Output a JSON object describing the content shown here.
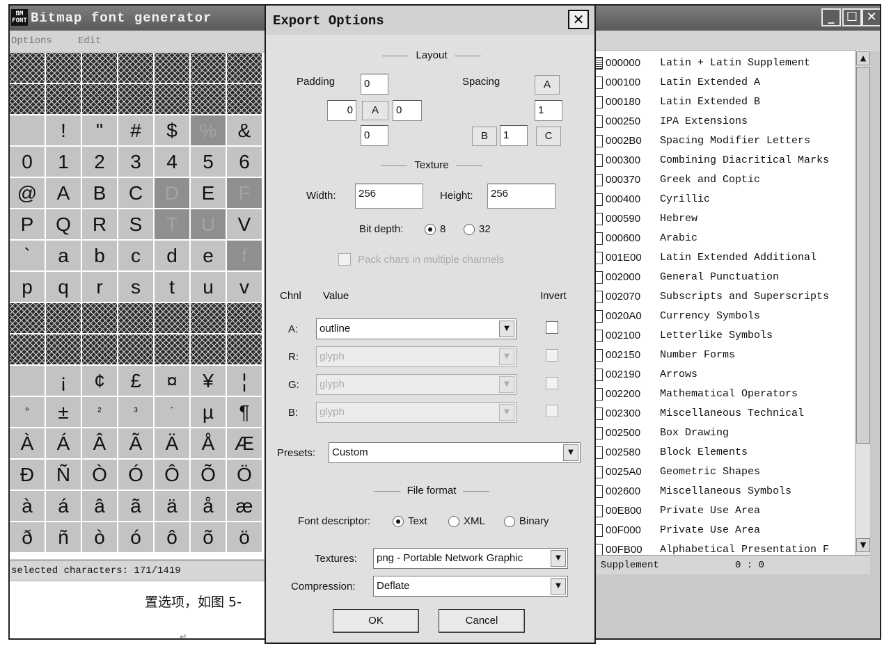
{
  "app": {
    "title": "Bitmap font generator",
    "icon_text": "BM\nFONT",
    "menu": [
      "Options",
      "Edit"
    ],
    "window_buttons": [
      "_",
      "☐",
      "✕"
    ]
  },
  "char_grid": {
    "rows": [
      {
        "type": "hatch"
      },
      {
        "type": "hatch"
      },
      {
        "cells": [
          " ",
          "!",
          "\"",
          "#",
          "$",
          "%",
          "&"
        ],
        "selected": [
          5
        ]
      },
      {
        "cells": [
          "0",
          "1",
          "2",
          "3",
          "4",
          "5",
          "6"
        ],
        "selected": []
      },
      {
        "cells": [
          "@",
          "A",
          "B",
          "C",
          "D",
          "E",
          "F"
        ],
        "selected": [
          4,
          6
        ]
      },
      {
        "cells": [
          "P",
          "Q",
          "R",
          "S",
          "T",
          "U",
          "V"
        ],
        "selected": [
          4,
          5
        ]
      },
      {
        "cells": [
          "`",
          "a",
          "b",
          "c",
          "d",
          "e",
          "f"
        ],
        "selected": [
          6
        ]
      },
      {
        "cells": [
          "p",
          "q",
          "r",
          "s",
          "t",
          "u",
          "v"
        ],
        "selected": []
      },
      {
        "type": "hatch"
      },
      {
        "type": "hatch"
      },
      {
        "cells": [
          " ",
          "¡",
          "¢",
          "£",
          "¤",
          "¥",
          "¦"
        ],
        "selected": []
      },
      {
        "cells": [
          "°",
          "±",
          "²",
          "³",
          "´",
          "µ",
          "¶"
        ],
        "selected": [],
        "small": [
          0,
          2,
          3,
          4
        ]
      },
      {
        "cells": [
          "À",
          "Á",
          "Â",
          "Ã",
          "Ä",
          "Å",
          "Æ"
        ],
        "selected": []
      },
      {
        "cells": [
          "Ð",
          "Ñ",
          "Ò",
          "Ó",
          "Ô",
          "Õ",
          "Ö"
        ],
        "selected": []
      },
      {
        "cells": [
          "à",
          "á",
          "â",
          "ã",
          "ä",
          "å",
          "æ"
        ],
        "selected": []
      },
      {
        "cells": [
          "ð",
          "ñ",
          "ò",
          "ó",
          "ô",
          "õ",
          "ö"
        ],
        "selected": []
      }
    ]
  },
  "status_left": "selected characters: 171/1419",
  "doc_text": "置选项，如图 5-",
  "doc_cursor": "↵",
  "status_right": {
    "label": "n Supplement",
    "position": "0 : 0"
  },
  "ranges": [
    {
      "code": "000000",
      "name": "Latin + Latin Supplement",
      "state": "partial"
    },
    {
      "code": "000100",
      "name": "Latin Extended A",
      "state": "off"
    },
    {
      "code": "000180",
      "name": "Latin Extended B",
      "state": "off"
    },
    {
      "code": "000250",
      "name": "IPA Extensions",
      "state": "off"
    },
    {
      "code": "0002B0",
      "name": "Spacing Modifier Letters",
      "state": "off"
    },
    {
      "code": "000300",
      "name": "Combining Diacritical Marks",
      "state": "off"
    },
    {
      "code": "000370",
      "name": "Greek and Coptic",
      "state": "off"
    },
    {
      "code": "000400",
      "name": "Cyrillic",
      "state": "off"
    },
    {
      "code": "000590",
      "name": "Hebrew",
      "state": "off"
    },
    {
      "code": "000600",
      "name": "Arabic",
      "state": "off"
    },
    {
      "code": "001E00",
      "name": "Latin Extended Additional",
      "state": "off"
    },
    {
      "code": "002000",
      "name": "General Punctuation",
      "state": "off"
    },
    {
      "code": "002070",
      "name": "Subscripts and Superscripts",
      "state": "off"
    },
    {
      "code": "0020A0",
      "name": "Currency Symbols",
      "state": "off"
    },
    {
      "code": "002100",
      "name": "Letterlike Symbols",
      "state": "off"
    },
    {
      "code": "002150",
      "name": "Number Forms",
      "state": "off"
    },
    {
      "code": "002190",
      "name": "Arrows",
      "state": "off"
    },
    {
      "code": "002200",
      "name": "Mathematical Operators",
      "state": "off"
    },
    {
      "code": "002300",
      "name": "Miscellaneous Technical",
      "state": "off"
    },
    {
      "code": "002500",
      "name": "Box Drawing",
      "state": "off"
    },
    {
      "code": "002580",
      "name": "Block Elements",
      "state": "off"
    },
    {
      "code": "0025A0",
      "name": "Geometric Shapes",
      "state": "off"
    },
    {
      "code": "002600",
      "name": "Miscellaneous Symbols",
      "state": "off"
    },
    {
      "code": "00E800",
      "name": "Private Use Area",
      "state": "off"
    },
    {
      "code": "00F000",
      "name": "Private Use Area",
      "state": "off"
    },
    {
      "code": "00FB00",
      "name": "Alphabetical Presentation F",
      "state": "off"
    }
  ],
  "dialog": {
    "title": "Export Options",
    "close": "✕",
    "layout": {
      "heading": "Layout",
      "padding_label": "Padding",
      "padding_top": "0",
      "padding_left": "0",
      "padding_channel": "A",
      "padding_right": "0",
      "padding_bottom": "0",
      "spacing_label": "Spacing",
      "spacing_a": "A",
      "spacing_value": "1",
      "spacing_b": "B",
      "spacing_b_value": "1",
      "spacing_c": "C"
    },
    "texture": {
      "heading": "Texture",
      "width_label": "Width:",
      "width": "256",
      "height_label": "Height:",
      "height": "256",
      "bitdepth_label": "Bit depth:",
      "bitdepth_options": [
        "8",
        "32"
      ],
      "bitdepth_selected": "8",
      "pack_label": "Pack chars in multiple channels",
      "pack_checked": false
    },
    "channels": {
      "col_chnl": "Chnl",
      "col_value": "Value",
      "col_invert": "Invert",
      "rows": [
        {
          "channel": "A:",
          "value": "outline",
          "enabled": true,
          "invert": false
        },
        {
          "channel": "R:",
          "value": "glyph",
          "enabled": false,
          "invert": false
        },
        {
          "channel": "G:",
          "value": "glyph",
          "enabled": false,
          "invert": false
        },
        {
          "channel": "B:",
          "value": "glyph",
          "enabled": false,
          "invert": false
        }
      ]
    },
    "presets": {
      "label": "Presets:",
      "value": "Custom"
    },
    "file_format": {
      "heading": "File format",
      "descriptor_label": "Font descriptor:",
      "descriptor_options": [
        "Text",
        "XML",
        "Binary"
      ],
      "descriptor_selected": "Text",
      "textures_label": "Textures:",
      "textures_value": "png - Portable Network Graphic",
      "compression_label": "Compression:",
      "compression_value": "Deflate"
    },
    "ok": "OK",
    "cancel": "Cancel"
  },
  "colors": {
    "selected_cell": "#8f8f8f",
    "cell": "#c3c3c3",
    "titlebar": "#5a5a5a",
    "dialog_body": "#e0e0e0"
  }
}
